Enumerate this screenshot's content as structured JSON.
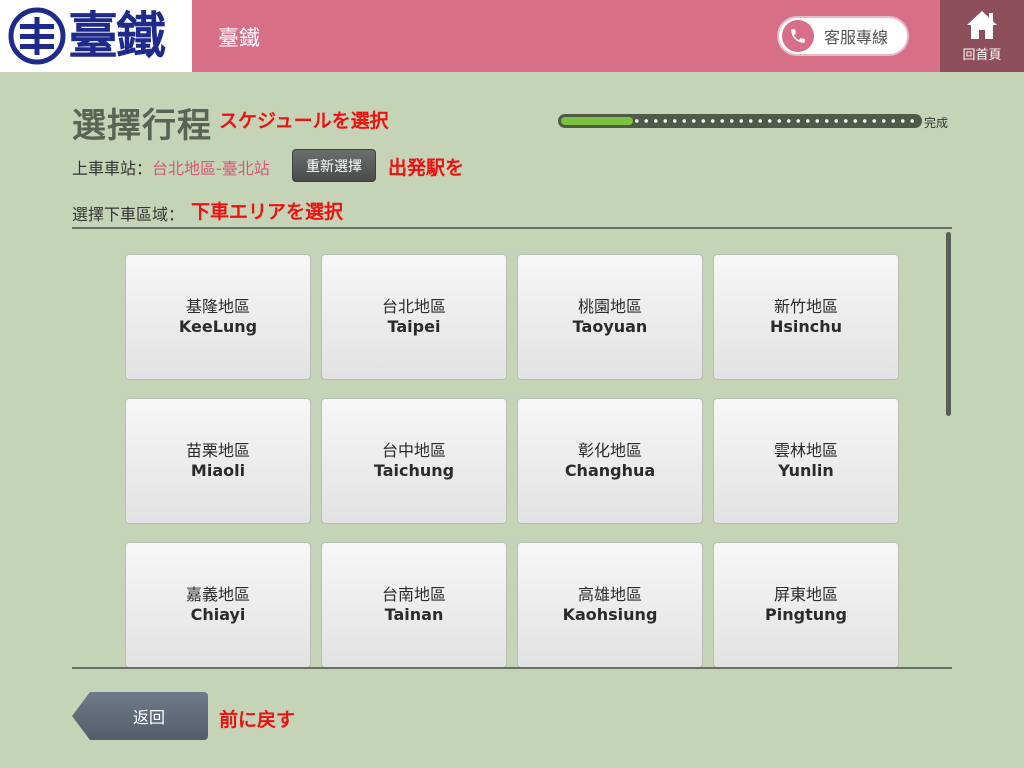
{
  "header": {
    "logo_text": "臺鐵",
    "title": "臺鐵",
    "hotline_label": "客服專線",
    "home_label": "回首頁",
    "brand_color": "#d76f88",
    "logo_color": "#1e2b8c"
  },
  "page": {
    "title": "選擇行程",
    "title_annotation": "スケジュールを選択",
    "progress": {
      "fraction": 0.2,
      "end_label": "完成"
    },
    "departure": {
      "label": "上車車站：",
      "value": "台北地區-臺北站",
      "reselect_label": "重新選擇",
      "annotation": "出発駅を"
    },
    "arrival_area": {
      "label": "選擇下車區域：",
      "annotation": "下車エリアを選択"
    }
  },
  "regions": [
    {
      "zh": "基隆地區",
      "en": "KeeLung"
    },
    {
      "zh": "台北地區",
      "en": "Taipei"
    },
    {
      "zh": "桃園地區",
      "en": "Taoyuan"
    },
    {
      "zh": "新竹地區",
      "en": "Hsinchu"
    },
    {
      "zh": "苗栗地區",
      "en": "Miaoli"
    },
    {
      "zh": "台中地區",
      "en": "Taichung"
    },
    {
      "zh": "彰化地區",
      "en": "Changhua"
    },
    {
      "zh": "雲林地區",
      "en": "Yunlin"
    },
    {
      "zh": "嘉義地區",
      "en": "Chiayi"
    },
    {
      "zh": "台南地區",
      "en": "Tainan"
    },
    {
      "zh": "高雄地區",
      "en": "Kaohsiung"
    },
    {
      "zh": "屏東地區",
      "en": "Pingtung"
    }
  ],
  "footer": {
    "back_label": "返回",
    "back_annotation": "前に戻す"
  }
}
